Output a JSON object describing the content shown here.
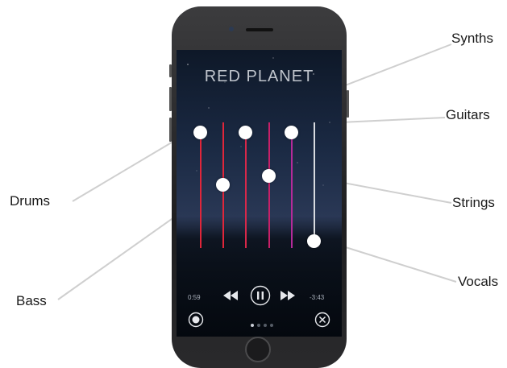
{
  "callouts": {
    "synths": "Synths",
    "guitars": "Guitars",
    "drums": "Drums",
    "strings": "Strings",
    "bass": "Bass",
    "vocals": "Vocals"
  },
  "app": {
    "title": "RED PLANET",
    "elapsed": "0:59",
    "remaining": "-3:43",
    "pages": 4,
    "active_page": 1
  },
  "faders": [
    {
      "name": "drums",
      "color": "#e0263a"
    },
    {
      "name": "bass",
      "color": "#e0263a"
    },
    {
      "name": "synths",
      "color": "#d8284a"
    },
    {
      "name": "strings",
      "color": "#c82068"
    },
    {
      "name": "guitars",
      "color": "#b52a9a"
    },
    {
      "name": "vocals",
      "color": "#d8dbe0"
    }
  ],
  "icons": {
    "rewind": "rewind-icon",
    "pause": "pause-icon",
    "fast_forward": "fast-forward-icon",
    "record": "record-icon",
    "close": "close-icon"
  }
}
